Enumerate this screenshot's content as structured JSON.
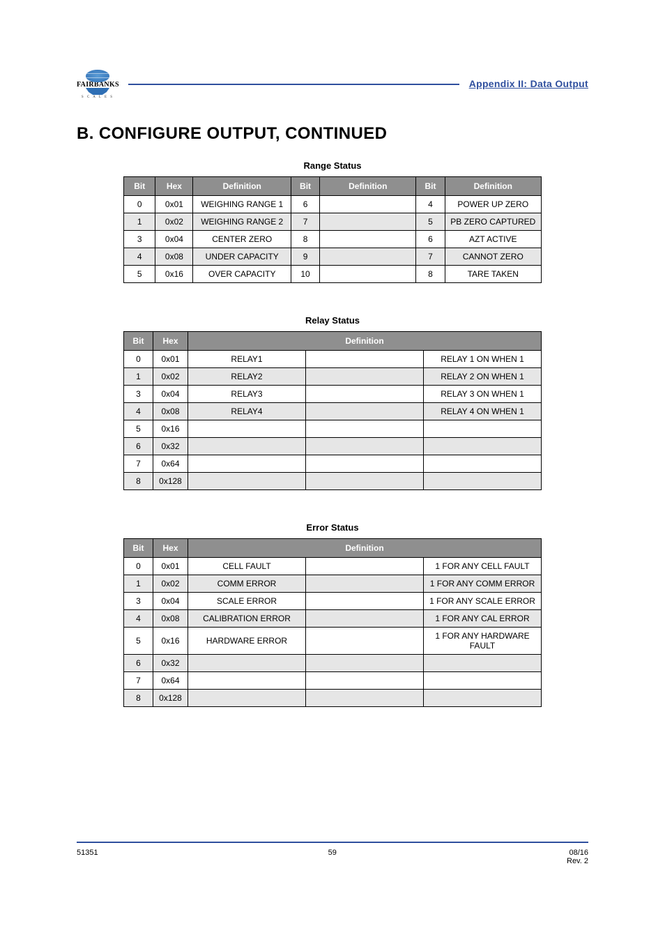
{
  "header": {
    "appendix": "Appendix II: Data Output",
    "logo_text": "FAIRBANKS",
    "logo_sub": "S C A L E S"
  },
  "section_title": "B.  CONFIGURE OUTPUT, CONTINUED",
  "tables": {
    "rangeStatus": {
      "title": "Range Status",
      "head_groups": [
        {
          "bit": "Bit",
          "hex": "Hex",
          "def": "Definition"
        },
        {
          "bit": "Bit",
          "def": "Definition"
        },
        {
          "bit": "Bit",
          "def": "Definition"
        }
      ],
      "rows": [
        {
          "c": [
            "0",
            "0x01",
            "WEIGHING RANGE 1",
            "6",
            "",
            "4",
            "POWER UP ZERO"
          ]
        },
        {
          "c": [
            "1",
            "0x02",
            "WEIGHING RANGE 2",
            "7",
            "",
            "5",
            "PB ZERO CAPTURED"
          ]
        },
        {
          "c": [
            "3",
            "0x04",
            "CENTER ZERO",
            "8",
            "",
            "6",
            "AZT ACTIVE"
          ]
        },
        {
          "c": [
            "4",
            "0x08",
            "UNDER CAPACITY",
            "9",
            "",
            "7",
            "CANNOT ZERO"
          ]
        },
        {
          "c": [
            "5",
            "0x16",
            "OVER CAPACITY",
            "10",
            "",
            "8",
            "TARE TAKEN"
          ]
        }
      ]
    },
    "relayStatus": {
      "title": "Relay Status",
      "head": {
        "bit": "Bit",
        "hex": "Hex",
        "def": "Definition"
      },
      "rows": [
        {
          "c": [
            "0",
            "0x01",
            "RELAY1",
            "",
            "RELAY 1 ON WHEN 1"
          ]
        },
        {
          "c": [
            "1",
            "0x02",
            "RELAY2",
            "",
            "RELAY 2 ON WHEN 1"
          ]
        },
        {
          "c": [
            "3",
            "0x04",
            "RELAY3",
            "",
            "RELAY 3 ON WHEN 1"
          ]
        },
        {
          "c": [
            "4",
            "0x08",
            "RELAY4",
            "",
            "RELAY 4 ON WHEN 1"
          ]
        },
        {
          "c": [
            "5",
            "0x16",
            "",
            "",
            ""
          ]
        },
        {
          "c": [
            "6",
            "0x32",
            "",
            "",
            ""
          ]
        },
        {
          "c": [
            "7",
            "0x64",
            "",
            "",
            ""
          ]
        },
        {
          "c": [
            "8",
            "0x128",
            "",
            "",
            ""
          ]
        }
      ]
    },
    "errorStatus": {
      "title": "Error Status",
      "head": {
        "bit": "Bit",
        "hex": "Hex",
        "def": "Definition"
      },
      "rows": [
        {
          "c": [
            "0",
            "0x01",
            "CELL FAULT",
            "",
            "1 FOR ANY CELL FAULT"
          ]
        },
        {
          "c": [
            "1",
            "0x02",
            "COMM ERROR",
            "",
            "1 FOR ANY COMM ERROR"
          ]
        },
        {
          "c": [
            "3",
            "0x04",
            "SCALE ERROR",
            "",
            "1 FOR ANY SCALE ERROR"
          ]
        },
        {
          "c": [
            "4",
            "0x08",
            "CALIBRATION ERROR",
            "",
            "1 FOR ANY CAL ERROR"
          ]
        },
        {
          "c": [
            "5",
            "0x16",
            "HARDWARE ERROR",
            "",
            "1 FOR ANY HARDWARE FAULT"
          ]
        },
        {
          "c": [
            "6",
            "0x32",
            "",
            "",
            ""
          ]
        },
        {
          "c": [
            "7",
            "0x64",
            "",
            "",
            ""
          ]
        },
        {
          "c": [
            "8",
            "0x128",
            "",
            "",
            ""
          ]
        }
      ]
    }
  },
  "footer": {
    "left": "51351",
    "center": "59",
    "right_line1": "08/16",
    "right_line2": "Rev. 2"
  }
}
